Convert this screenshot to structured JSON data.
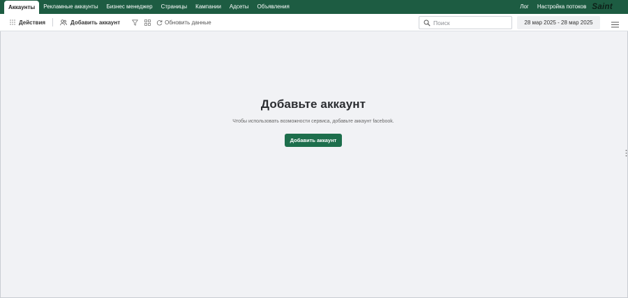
{
  "nav": {
    "tabs": [
      {
        "label": "Аккаунты",
        "active": true
      },
      {
        "label": "Рекламные аккаунты"
      },
      {
        "label": "Бизнес менеджер"
      },
      {
        "label": "Страницы"
      },
      {
        "label": "Кампании"
      },
      {
        "label": "Адсеты"
      },
      {
        "label": "Объявления"
      }
    ],
    "log": "Лог",
    "flows_settings": "Настройка потоков",
    "brand": "Saint",
    "bg_color": "#1d5c42"
  },
  "toolbar": {
    "actions_label": "Действия",
    "add_account_label": "Добавить аккаунт",
    "refresh_label": "Обновить данные",
    "search_placeholder": "Поиск",
    "date_range": "28 мар 2025 - 28 мар 2025"
  },
  "empty_state": {
    "title": "Добавьте аккаунт",
    "description": "Чтобы использовать возможности сервиса, добавьте аккаунт facebook.",
    "button_label": "Добавить аккаунт",
    "button_color": "#1d6e4c"
  },
  "icons": [
    "grid-dots-icon",
    "users-add-icon",
    "filter-icon",
    "columns-icon",
    "refresh-icon",
    "search-icon",
    "hamburger-menu-icon",
    "drag-handle-icon"
  ]
}
